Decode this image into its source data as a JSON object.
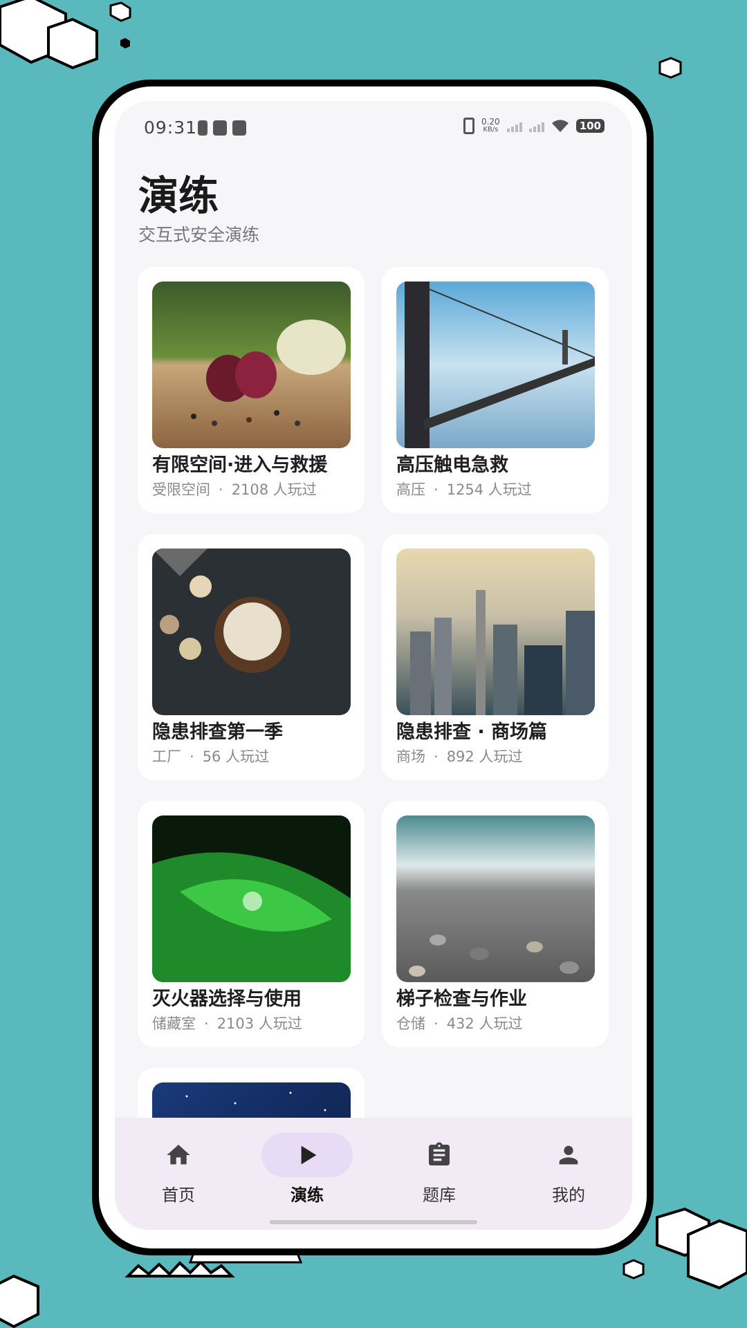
{
  "status_bar": {
    "time": "09:31",
    "net_speed_value": "0.20",
    "net_speed_unit": "KB/s",
    "battery": "100"
  },
  "header": {
    "title": "演练",
    "subtitle": "交互式安全演练"
  },
  "drills": [
    {
      "title": "有限空间·进入与救援",
      "category": "受限空间",
      "separator": "·",
      "players": "2108 人玩过",
      "image": "vegetables-cutting-board"
    },
    {
      "title": "高压触电急救",
      "category": "高压",
      "separator": "·",
      "players": "1254 人玩过",
      "image": "suspension-bridge-fog"
    },
    {
      "title": "隐患排查第一季",
      "category": "工厂",
      "separator": "·",
      "players": "56 人玩过",
      "image": "dessert-dark-table"
    },
    {
      "title": "隐患排查 · 商场篇",
      "category": "商场",
      "separator": "·",
      "players": "892 人玩过",
      "image": "city-skyline"
    },
    {
      "title": "灭火器选择与使用",
      "category": "储藏室",
      "separator": "·",
      "players": "2103 人玩过",
      "image": "green-leaf-droplet"
    },
    {
      "title": "梯子检查与作业",
      "category": "仓储",
      "separator": "·",
      "players": "432 人玩过",
      "image": "pebble-beach"
    },
    {
      "image": "starry-sky"
    }
  ],
  "nav": {
    "items": [
      {
        "label": "首页",
        "icon": "home-icon"
      },
      {
        "label": "演练",
        "icon": "play-icon",
        "active": true
      },
      {
        "label": "题库",
        "icon": "clipboard-icon"
      },
      {
        "label": "我的",
        "icon": "person-icon"
      }
    ]
  },
  "colors": {
    "background": "#5ab9bd",
    "screen": "#f6f6f8",
    "nav_bg": "#f2eaf4",
    "nav_active_pill": "#e8dbf6"
  }
}
